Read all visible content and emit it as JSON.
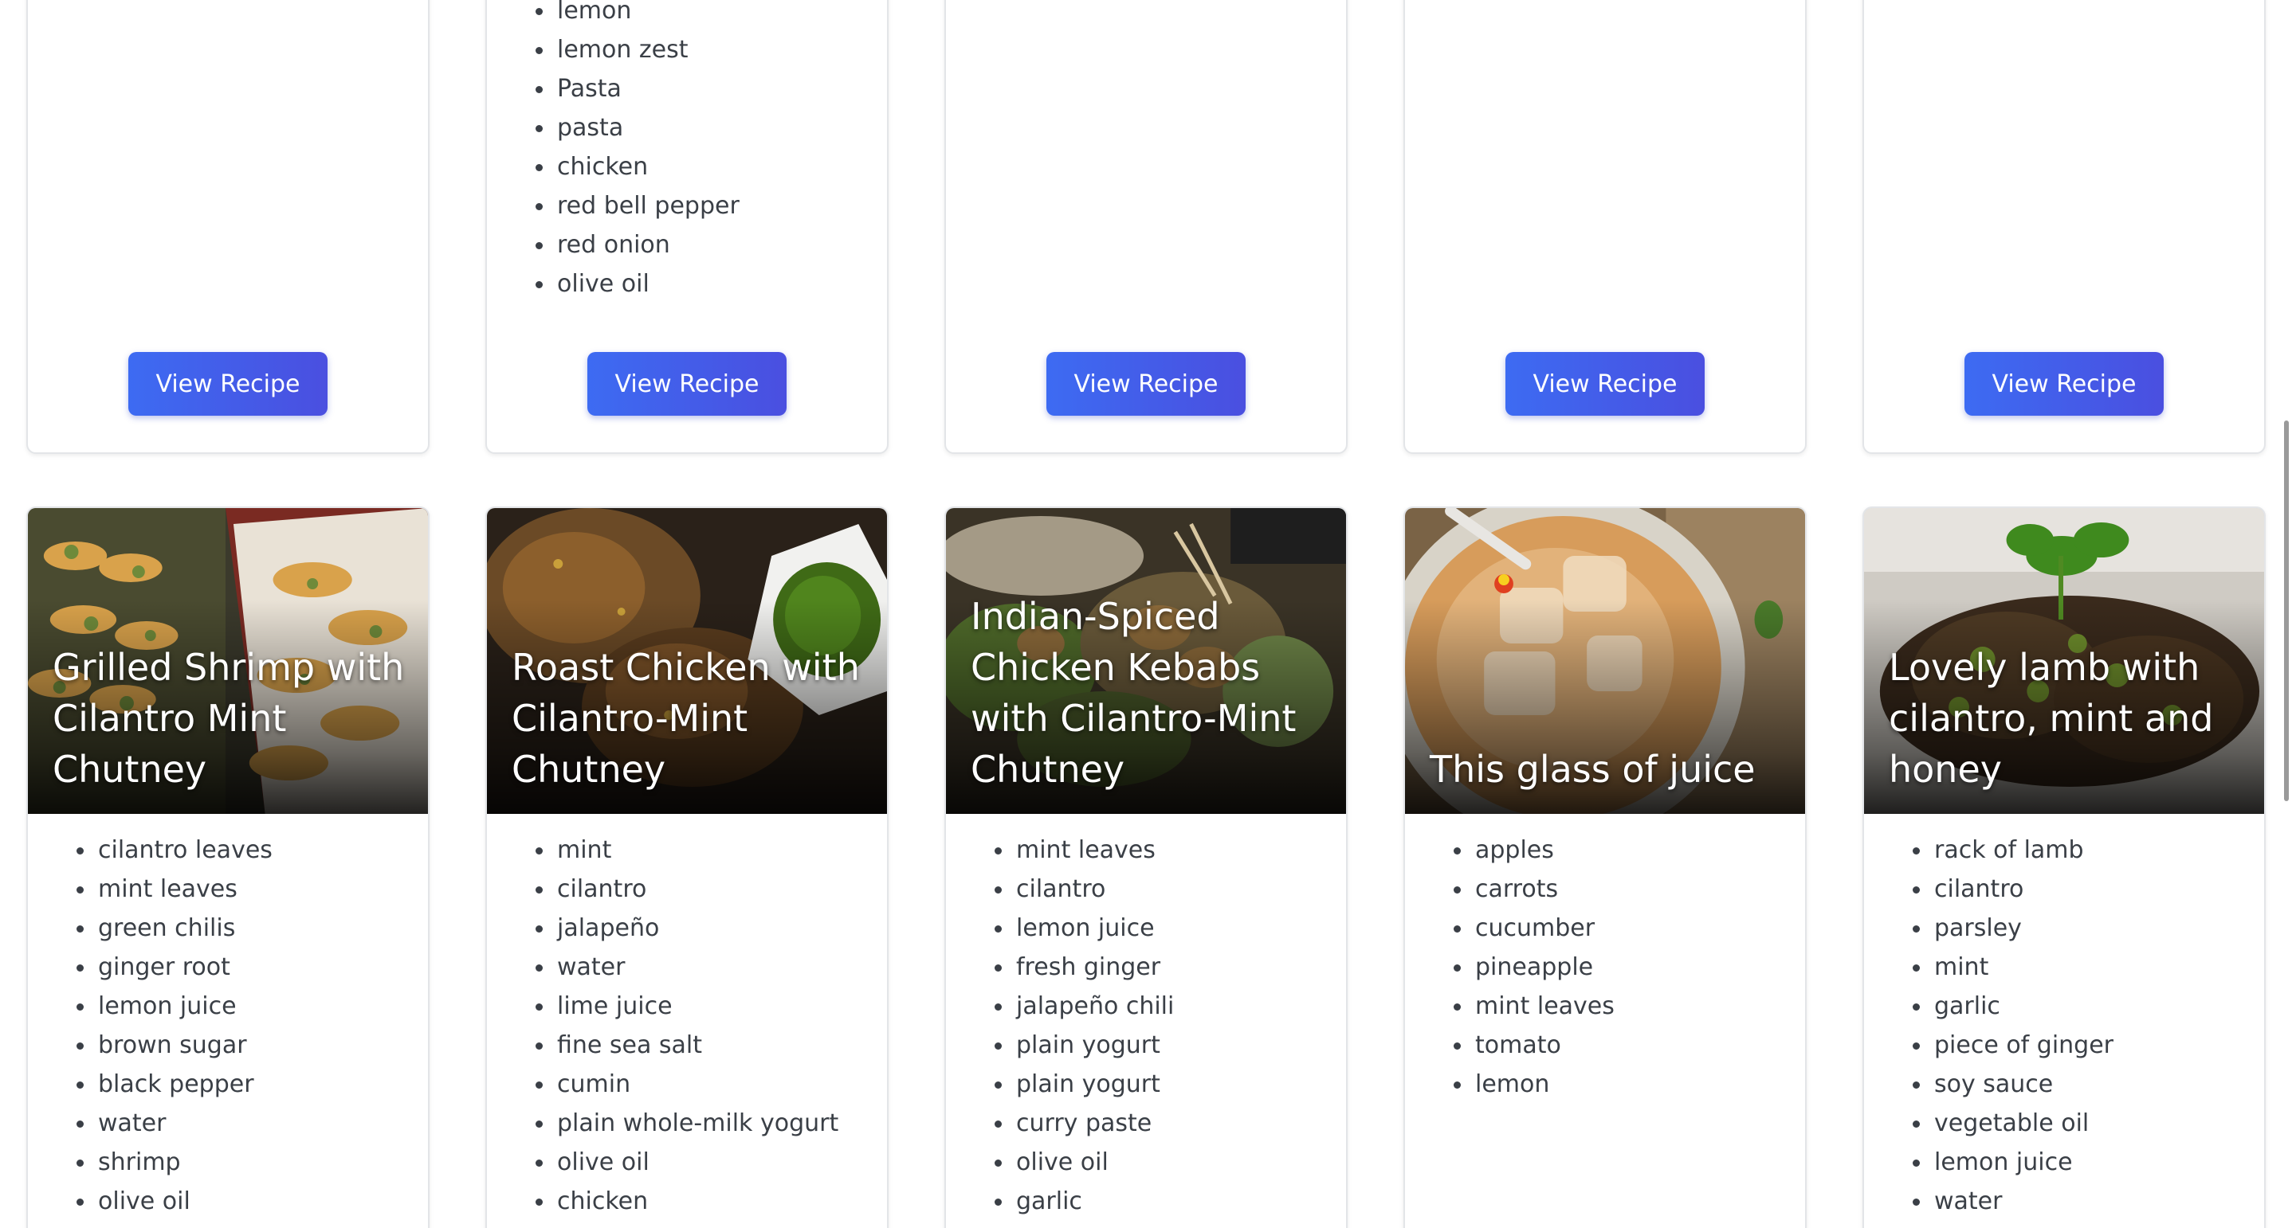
{
  "top_row": {
    "cards": [
      {
        "ingredients": [],
        "button_label": "View Recipe"
      },
      {
        "ingredients": [
          "lemon",
          "lemon zest",
          "Pasta",
          "pasta",
          "chicken",
          "red bell pepper",
          "red onion",
          "olive oil"
        ],
        "button_label": "View Recipe"
      },
      {
        "ingredients": [],
        "button_label": "View Recipe"
      },
      {
        "ingredients": [],
        "button_label": "View Recipe"
      },
      {
        "ingredients": [],
        "button_label": "View Recipe"
      }
    ]
  },
  "recipes": [
    {
      "title": "Grilled Shrimp with Cilantro Mint Chutney",
      "image_icon": "shrimp-skewers-photo",
      "ingredients": [
        "cilantro leaves",
        "mint leaves",
        "green chilis",
        "ginger root",
        "lemon juice",
        "brown sugar",
        "black pepper",
        "water",
        "shrimp",
        "olive oil"
      ]
    },
    {
      "title": "Roast Chicken with Cilantro-Mint Chutney",
      "image_icon": "roast-chicken-photo",
      "ingredients": [
        "mint",
        "cilantro",
        "jalapeño",
        "water",
        "lime juice",
        "fine sea salt",
        "cumin",
        "plain whole-milk yogurt",
        "olive oil",
        "chicken"
      ]
    },
    {
      "title": "Indian-Spiced Chicken Kebabs with Cilantro-Mint Chutney",
      "image_icon": "chicken-kebabs-photo",
      "ingredients": [
        "mint leaves",
        "cilantro",
        "lemon juice",
        "fresh ginger",
        "jalapeño chili",
        "plain yogurt",
        "plain yogurt",
        "curry paste",
        "olive oil",
        "garlic"
      ]
    },
    {
      "title": "This glass of juice",
      "image_icon": "juice-glass-photo",
      "ingredients": [
        "apples",
        "carrots",
        "cucumber",
        "pineapple",
        "mint leaves",
        "tomato",
        "lemon"
      ]
    },
    {
      "title": "Lovely lamb with cilantro, mint and honey",
      "image_icon": "lamb-chops-photo",
      "ingredients": [
        "rack of lamb",
        "cilantro",
        "parsley",
        "mint",
        "garlic",
        "piece of ginger",
        "soy sauce",
        "vegetable oil",
        "lemon juice",
        "water"
      ]
    }
  ],
  "colors": {
    "button_start": "#3d6bf2",
    "button_end": "#4a4fe0",
    "card_border": "#e3e5e8",
    "text": "#3a3f46"
  }
}
